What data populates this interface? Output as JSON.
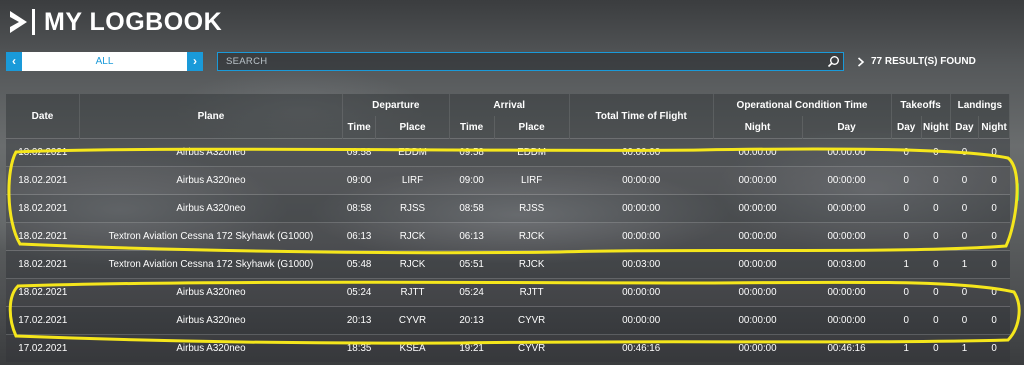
{
  "header": {
    "title": "MY LOGBOOK",
    "logo_icon": "chevron-logo-icon"
  },
  "filter": {
    "selected": "ALL",
    "prev_icon": "chevron-left-icon",
    "next_icon": "chevron-right-icon"
  },
  "search": {
    "placeholder": "SEARCH",
    "icon": "search-icon"
  },
  "results": {
    "label": "77 RESULT(S) FOUND"
  },
  "colors": {
    "accent": "#1a9ad9",
    "highlight": "#f5e61c"
  },
  "table": {
    "headers": {
      "date": "Date",
      "plane": "Plane",
      "departure": "Departure",
      "arrival": "Arrival",
      "total_time": "Total Time of Flight",
      "op_condition": "Operational Condition Time",
      "takeoffs": "Takeoffs",
      "landings": "Landings",
      "time": "Time",
      "place": "Place",
      "night": "Night",
      "day": "Day"
    },
    "rows": [
      {
        "date": "18.02.2021",
        "plane": "Airbus A320neo",
        "dep_time": "09:58",
        "dep_place": "EDDM",
        "arr_time": "09:58",
        "arr_place": "EDDM",
        "total": "00:00:00",
        "night": "00:00:00",
        "day": "00:00:00",
        "to_day": "0",
        "to_night": "0",
        "ld_day": "0",
        "ld_night": "0"
      },
      {
        "date": "18.02.2021",
        "plane": "Airbus A320neo",
        "dep_time": "09:00",
        "dep_place": "LIRF",
        "arr_time": "09:00",
        "arr_place": "LIRF",
        "total": "00:00:00",
        "night": "00:00:00",
        "day": "00:00:00",
        "to_day": "0",
        "to_night": "0",
        "ld_day": "0",
        "ld_night": "0"
      },
      {
        "date": "18.02.2021",
        "plane": "Airbus A320neo",
        "dep_time": "08:58",
        "dep_place": "RJSS",
        "arr_time": "08:58",
        "arr_place": "RJSS",
        "total": "00:00:00",
        "night": "00:00:00",
        "day": "00:00:00",
        "to_day": "0",
        "to_night": "0",
        "ld_day": "0",
        "ld_night": "0"
      },
      {
        "date": "18.02.2021",
        "plane": "Textron Aviation Cessna 172 Skyhawk (G1000)",
        "dep_time": "06:13",
        "dep_place": "RJCK",
        "arr_time": "06:13",
        "arr_place": "RJCK",
        "total": "00:00:00",
        "night": "00:00:00",
        "day": "00:00:00",
        "to_day": "0",
        "to_night": "0",
        "ld_day": "0",
        "ld_night": "0"
      },
      {
        "date": "18.02.2021",
        "plane": "Textron Aviation Cessna 172 Skyhawk (G1000)",
        "dep_time": "05:48",
        "dep_place": "RJCK",
        "arr_time": "05:51",
        "arr_place": "RJCK",
        "total": "00:03:00",
        "night": "00:00:00",
        "day": "00:03:00",
        "to_day": "1",
        "to_night": "0",
        "ld_day": "1",
        "ld_night": "0"
      },
      {
        "date": "18.02.2021",
        "plane": "Airbus A320neo",
        "dep_time": "05:24",
        "dep_place": "RJTT",
        "arr_time": "05:24",
        "arr_place": "RJTT",
        "total": "00:00:00",
        "night": "00:00:00",
        "day": "00:00:00",
        "to_day": "0",
        "to_night": "0",
        "ld_day": "0",
        "ld_night": "0"
      },
      {
        "date": "17.02.2021",
        "plane": "Airbus A320neo",
        "dep_time": "20:13",
        "dep_place": "CYVR",
        "arr_time": "20:13",
        "arr_place": "CYVR",
        "total": "00:00:00",
        "night": "00:00:00",
        "day": "00:00:00",
        "to_day": "0",
        "to_night": "0",
        "ld_day": "0",
        "ld_night": "0"
      },
      {
        "date": "17.02.2021",
        "plane": "Airbus A320neo",
        "dep_time": "18:35",
        "dep_place": "KSEA",
        "arr_time": "19:21",
        "arr_place": "CYVR",
        "total": "00:46:16",
        "night": "00:00:00",
        "day": "00:46:16",
        "to_day": "1",
        "to_night": "0",
        "ld_day": "1",
        "ld_night": "0"
      }
    ]
  }
}
